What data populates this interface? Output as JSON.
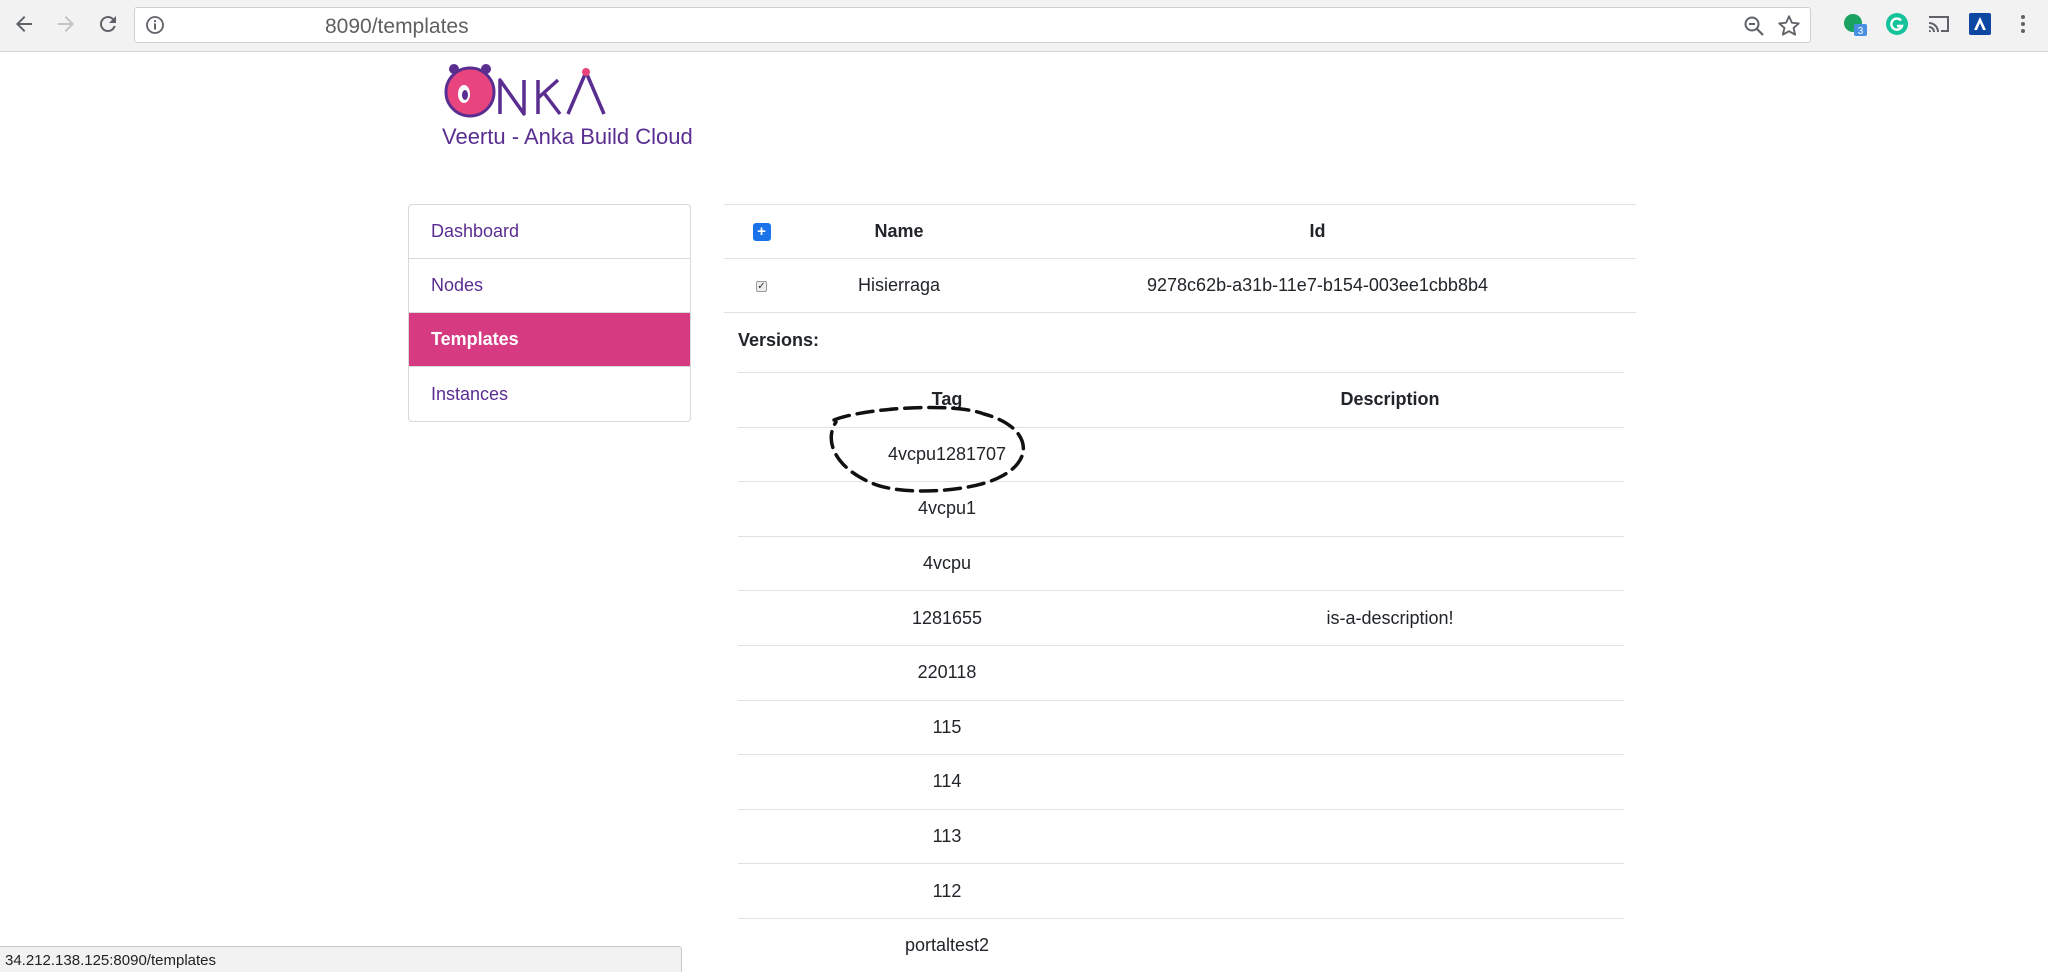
{
  "browser": {
    "url": "8090/templates",
    "extension_badge": "3"
  },
  "site": {
    "title": "Veertu - Anka Build Cloud",
    "logo_text": "ANKA",
    "brand_color": "#5a2d91",
    "accent_color": "#d63a80"
  },
  "sidebar": {
    "items": [
      {
        "label": "Dashboard",
        "active": false
      },
      {
        "label": "Nodes",
        "active": false
      },
      {
        "label": "Templates",
        "active": true
      },
      {
        "label": "Instances",
        "active": false
      }
    ]
  },
  "templates_table": {
    "add_icon": "plus-icon",
    "headers": {
      "name": "Name",
      "id": "Id"
    },
    "rows": [
      {
        "checked": true,
        "name": "Hisierraga",
        "id": "9278c62b-a31b-11e7-b154-003ee1cbb8b4"
      }
    ]
  },
  "versions": {
    "label": "Versions:",
    "headers": {
      "tag": "Tag",
      "description": "Description"
    },
    "rows": [
      {
        "tag": "4vcpu1281707",
        "description": ""
      },
      {
        "tag": "4vcpu1",
        "description": ""
      },
      {
        "tag": "4vcpu",
        "description": ""
      },
      {
        "tag": "1281655",
        "description": "is-a-description!"
      },
      {
        "tag": "220118",
        "description": ""
      },
      {
        "tag": "115",
        "description": ""
      },
      {
        "tag": "114",
        "description": ""
      },
      {
        "tag": "113",
        "description": ""
      },
      {
        "tag": "112",
        "description": ""
      },
      {
        "tag": "portaltest2",
        "description": ""
      }
    ]
  },
  "status_bar": {
    "text": "34.212.138.125:8090/templates"
  }
}
